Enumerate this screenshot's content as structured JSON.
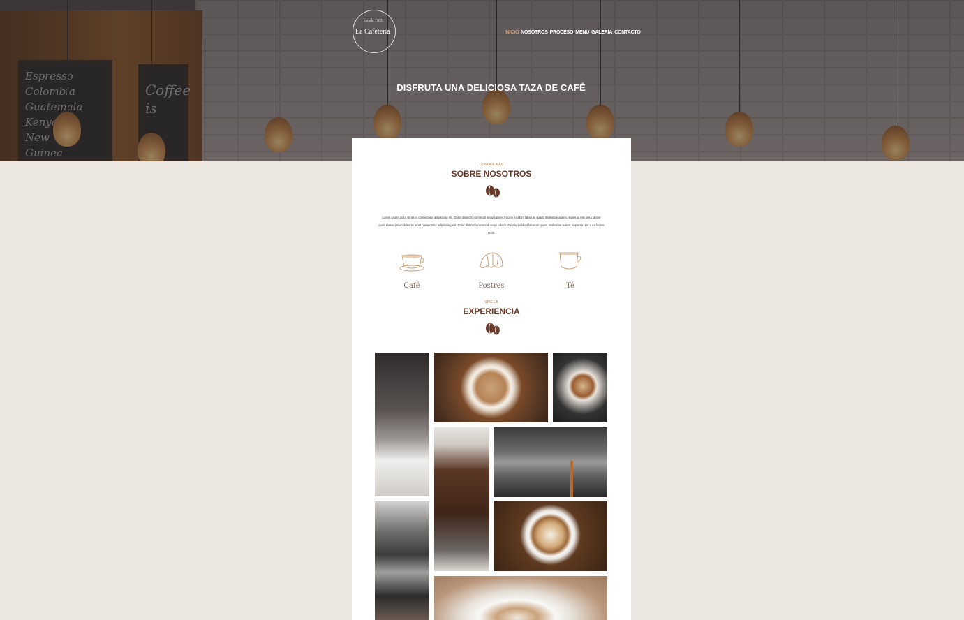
{
  "brand": {
    "name": "La Cafetería",
    "since": "desde 1959"
  },
  "nav": {
    "items": [
      {
        "label": "INICIO",
        "active": true
      },
      {
        "label": "NOSOTROS",
        "active": false
      },
      {
        "label": "PROCESO",
        "active": false
      },
      {
        "label": "MENÚ",
        "active": false
      },
      {
        "label": "GALERÍA",
        "active": false
      },
      {
        "label": "CONTACTO",
        "active": false
      }
    ]
  },
  "hero": {
    "tagline": "DISFRUTA UNA DELICIOSA TAZA DE CAFÉ"
  },
  "about": {
    "kicker": "CONOCE MÁS",
    "title": "SOBRE NOSOTROS",
    "body": "Lorem ipsum dolor sit amet consectetur adipisicing elit. Dolor distinctio commodi sequi labore. Facere incidunt laborum quam. Molestiae autem, sapiente rem a ea facere quos.Lorem ipsum dolor sit amet consectetur adipisicing elit. Dolor distinctio commodi sequi labore. Facere incidunt laborum quam. Molestiae autem, sapiente rem a ea facere quos.",
    "features": [
      {
        "label": "Café",
        "icon": "coffee-cup-icon"
      },
      {
        "label": "Postres",
        "icon": "croissant-icon"
      },
      {
        "label": "Té",
        "icon": "tea-cup-icon"
      }
    ]
  },
  "experience": {
    "kicker": "VIVE LA",
    "title": "EXPERIENCIA"
  },
  "colors": {
    "accent": "#c9a27a",
    "heading": "#6b3b2a",
    "page_bg": "#ebe6df"
  }
}
